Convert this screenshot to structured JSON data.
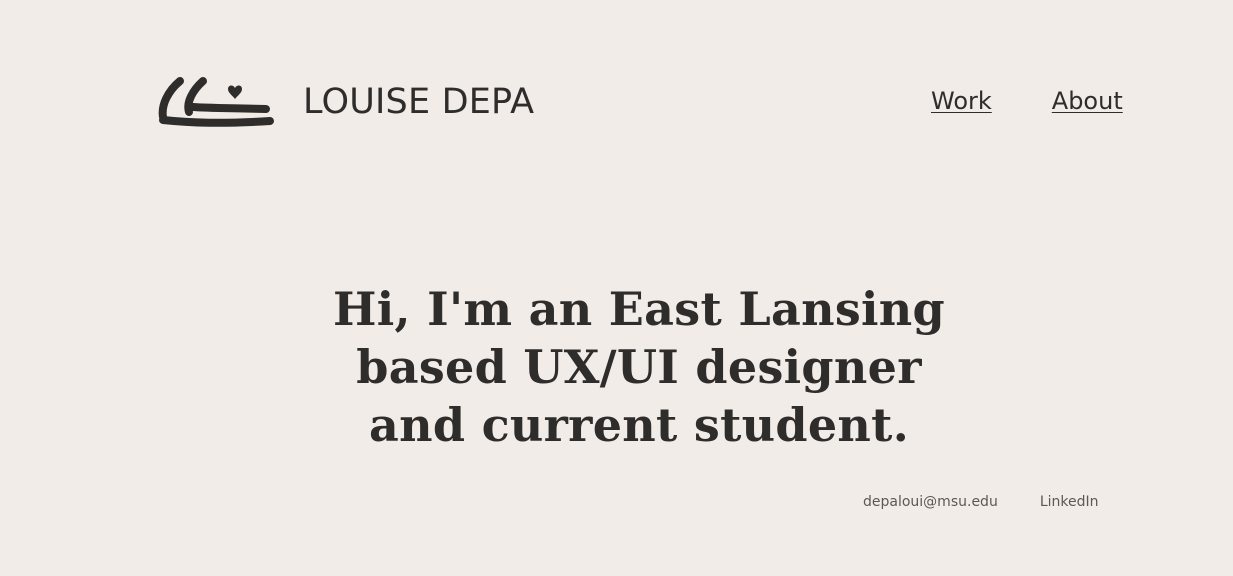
{
  "header": {
    "site_title": "LOUISE DEPA",
    "logo_icon": "handwritten-ll-heart-logo",
    "nav": [
      {
        "label": "Work"
      },
      {
        "label": "About"
      }
    ]
  },
  "hero": {
    "headline": "Hi, I'm an East Lansing based UX/UI designer and current student."
  },
  "footer": {
    "email": "depaloui@msu.edu",
    "linkedin": "LinkedIn"
  },
  "colors": {
    "background": "#f1ece8",
    "text": "#2f2d2c",
    "muted_text": "#5b5856"
  }
}
